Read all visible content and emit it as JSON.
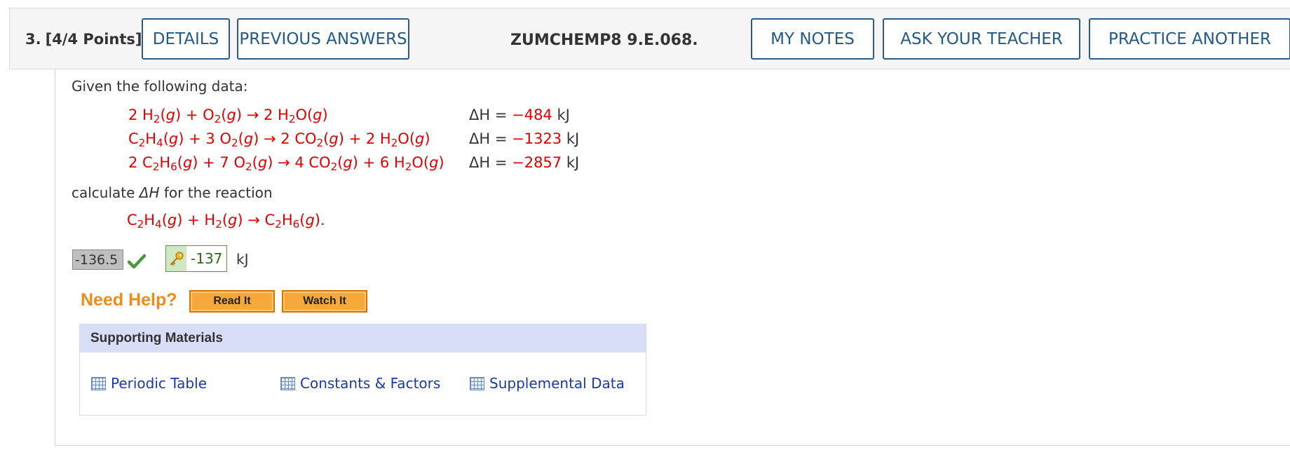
{
  "header": {
    "question_number": "3.",
    "points": "[4/4 Points]",
    "code": "ZUMCHEMP8 9.E.068.",
    "buttons": {
      "details": "DETAILS",
      "previous_answers": "PREVIOUS ANSWERS",
      "my_notes": "MY NOTES",
      "ask_teacher": "ASK YOUR TEACHER",
      "practice_another": "PRACTICE ANOTHER"
    }
  },
  "question": {
    "intro": "Given the following data:",
    "enthalpy_prefix": "ΔH = ",
    "unit_kj": "kJ",
    "reactions": [
      {
        "dh_value": "−484"
      },
      {
        "dh_value": "−1323"
      },
      {
        "dh_value": "−2857"
      }
    ],
    "calculate_prefix": "calculate ",
    "calculate_dh": "ΔH",
    "calculate_suffix": " for the reaction"
  },
  "answer": {
    "submitted_value": "-136.5",
    "key_value": "-137",
    "unit": "kJ"
  },
  "help": {
    "label": "Need Help?",
    "read_it": "Read It",
    "watch_it": "Watch It"
  },
  "supporting_materials": {
    "title": "Supporting Materials",
    "links": [
      "Periodic Table",
      "Constants & Factors",
      "Supplemental Data"
    ]
  },
  "colors": {
    "accent_blue": "#1f5a8a",
    "equation_red": "#e00000",
    "correct_green": "#5a9a3a",
    "help_orange": "#f08a18"
  }
}
